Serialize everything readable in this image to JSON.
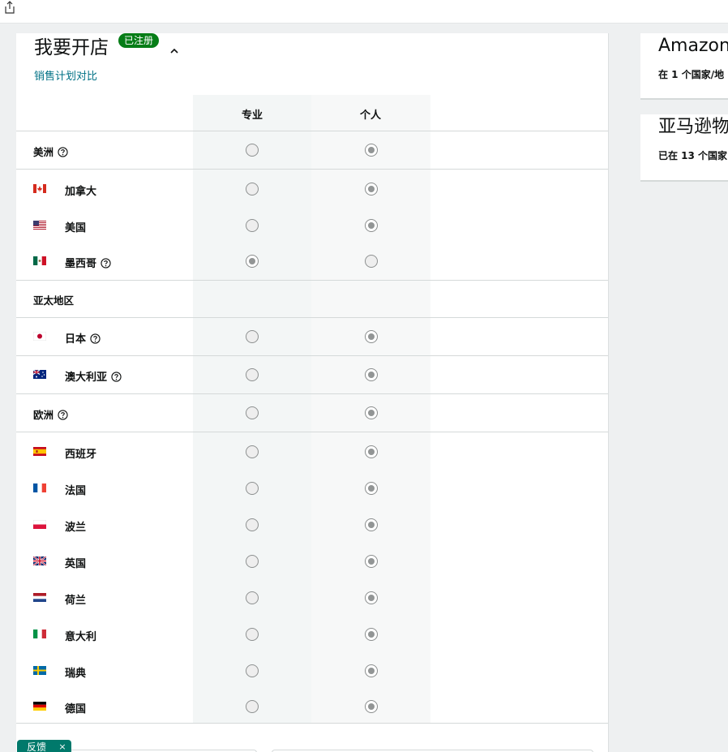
{
  "header": {
    "share_icon": "share-icon"
  },
  "card": {
    "title": "我要开店",
    "badge": "已注册",
    "collapse_icon": "chevron-up-icon",
    "compare_link": "销售计划对比",
    "columns": {
      "professional": "专业",
      "individual": "个人"
    },
    "help_icon": "question-circle-icon"
  },
  "regions": [
    {
      "name": "美洲",
      "help": true,
      "professional_selected": false,
      "individual_selected": true
    },
    {
      "name": "亚太地区",
      "help": false
    },
    {
      "name": "欧洲",
      "help": true,
      "professional_selected": false,
      "individual_selected": true
    }
  ],
  "countries": [
    {
      "name": "加拿大",
      "flag": "canada-flag-icon",
      "help": false,
      "professional_selected": false,
      "individual_selected": true
    },
    {
      "name": "美国",
      "flag": "usa-flag-icon",
      "help": false,
      "professional_selected": false,
      "individual_selected": true
    },
    {
      "name": "墨西哥",
      "flag": "mexico-flag-icon",
      "help": true,
      "professional_selected": true,
      "individual_selected": false
    },
    {
      "name": "日本",
      "flag": "japan-flag-icon",
      "help": true,
      "professional_selected": false,
      "individual_selected": true
    },
    {
      "name": "澳大利亚",
      "flag": "australia-flag-icon",
      "help": true,
      "professional_selected": false,
      "individual_selected": true
    },
    {
      "name": "西班牙",
      "flag": "spain-flag-icon",
      "help": false,
      "professional_selected": false,
      "individual_selected": true
    },
    {
      "name": "法国",
      "flag": "france-flag-icon",
      "help": false,
      "professional_selected": false,
      "individual_selected": true
    },
    {
      "name": "波兰",
      "flag": "poland-flag-icon",
      "help": false,
      "professional_selected": false,
      "individual_selected": true
    },
    {
      "name": "英国",
      "flag": "uk-flag-icon",
      "help": false,
      "professional_selected": false,
      "individual_selected": true
    },
    {
      "name": "荷兰",
      "flag": "netherlands-flag-icon",
      "help": false,
      "professional_selected": false,
      "individual_selected": true
    },
    {
      "name": "意大利",
      "flag": "italy-flag-icon",
      "help": false,
      "professional_selected": false,
      "individual_selected": true
    },
    {
      "name": "瑞典",
      "flag": "sweden-flag-icon",
      "help": false,
      "professional_selected": false,
      "individual_selected": true
    },
    {
      "name": "德国",
      "flag": "germany-flag-icon",
      "help": false,
      "professional_selected": false,
      "individual_selected": true
    }
  ],
  "side_cards": [
    {
      "title": "Amazon",
      "subtitle": "在 1 个国家/地"
    },
    {
      "title": "亚马逊物",
      "subtitle": "已在 13 个国家"
    }
  ],
  "feedback": {
    "label": "反馈",
    "close": "×"
  },
  "colors": {
    "link": "#007185",
    "badge_bg": "#067d17",
    "feedback_bg": "#00796b",
    "column_bg": "#f3f6f6"
  }
}
